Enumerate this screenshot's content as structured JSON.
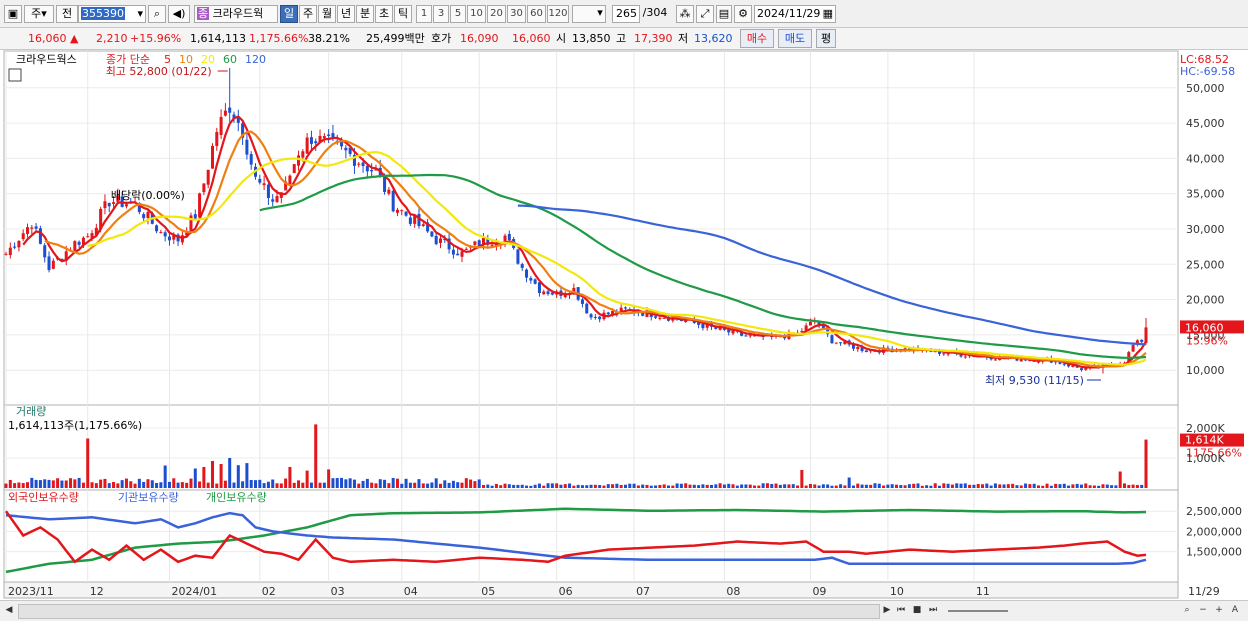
{
  "toolbar": {
    "market_type": "주",
    "prev_label": "전",
    "code": "355390",
    "name_badge": "종",
    "stock_name": "크라우드웍",
    "periods": [
      "일",
      "주",
      "월",
      "년",
      "분",
      "초",
      "틱"
    ],
    "selected_period": "일",
    "intervals": [
      "1",
      "3",
      "5",
      "10",
      "20",
      "30",
      "60",
      "120"
    ],
    "count": "265",
    "total": "/304",
    "date": "2024/11/29"
  },
  "quote": {
    "price": "16,060",
    "change_arrow": "▲",
    "change": "2,210",
    "change_pct": "+15.96%",
    "volume": "1,614,113",
    "volume_pct": "1,175.66%",
    "turnover": "38.21%",
    "amount": "25,499백만",
    "ask_label": "호가",
    "ask": "16,090",
    "bid": "16,060",
    "open_label": "시",
    "open": "13,850",
    "high_label": "고",
    "high": "17,390",
    "low_label": "저",
    "low": "13,620",
    "buy_btn": "매수",
    "sell_btn": "매도",
    "eval_btn": "평"
  },
  "chart_data": [
    {
      "type": "candlestick",
      "title": "크라우드웍스",
      "ma_label": "종가 단순",
      "ma_periods": [
        "5",
        "10",
        "20",
        "60",
        "120"
      ],
      "ma_colors": [
        "#e3161b",
        "#f07f12",
        "#f2e80c",
        "#1f9a45",
        "#3b63d9"
      ],
      "ylim": [
        5500,
        54500
      ],
      "ytick_labels": [
        "50,000",
        "45,000",
        "40,000",
        "35,000",
        "30,000",
        "25,000",
        "20,000",
        "15,000",
        "10,000"
      ],
      "yticks": [
        50000,
        45000,
        40000,
        35000,
        30000,
        25000,
        20000,
        15000,
        10000
      ],
      "x_labels": [
        "2023/11",
        "12",
        "2024/01",
        "02",
        "03",
        "04",
        "05",
        "06",
        "07",
        "08",
        "09",
        "10",
        "11",
        "11/29"
      ],
      "x_label_days": [
        0,
        19,
        38,
        59,
        75,
        92,
        110,
        128,
        146,
        167,
        187,
        205,
        225,
        265
      ],
      "close_anchor_days": [
        0,
        6,
        10,
        16,
        19,
        24,
        30,
        36,
        40,
        44,
        46,
        49,
        52,
        55,
        58,
        62,
        65,
        68,
        71,
        75,
        80,
        86,
        90,
        95,
        100,
        106,
        110,
        116,
        120,
        124,
        128,
        132,
        136,
        140,
        144,
        150,
        158,
        164,
        172,
        178,
        184,
        188,
        192,
        200,
        210,
        218,
        226,
        236,
        243,
        250,
        256,
        260,
        262,
        264,
        265
      ],
      "close_anchor_values": [
        26500,
        31000,
        24500,
        28000,
        29000,
        34000,
        33500,
        29500,
        28500,
        32000,
        36500,
        44000,
        47500,
        44000,
        37000,
        34000,
        36000,
        41000,
        43000,
        42000,
        40500,
        38000,
        33500,
        31000,
        28500,
        26500,
        28000,
        29000,
        24500,
        21500,
        20800,
        21500,
        17500,
        18000,
        18500,
        18000,
        17000,
        16000,
        14800,
        14600,
        15200,
        17000,
        14200,
        12800,
        13000,
        12500,
        12000,
        11600,
        11400,
        10200,
        10600,
        11300,
        13500,
        14200,
        16060
      ],
      "high_label": "최고 52,800 (01/22)",
      "high_value": 52800,
      "high_day": 52,
      "low_label": "최저 9,530 (11/15)",
      "low_value": 9530,
      "low_day": 255,
      "dividend_label": "배당락(0.00%)",
      "dividend_day": 36,
      "lc_label": "LC:68.52",
      "hc_label": "HC:-69.58",
      "last_price_tag": "16,060",
      "last_pct_tag": "15.96%",
      "last_close": 16060
    },
    {
      "type": "bar",
      "title": "거래량",
      "subtitle": "1,614,113주(1,175.66%)",
      "ylim": [
        0,
        2600000
      ],
      "ytick_labels": [
        "2,000K",
        "1,000K"
      ],
      "yticks": [
        2000000,
        1000000
      ],
      "last_tag": "1,614K",
      "last_pct_tag": "1175.66%",
      "spike_days": [
        19,
        37,
        44,
        46,
        48,
        50,
        52,
        54,
        56,
        66,
        70,
        72,
        75,
        185,
        196,
        259,
        265
      ],
      "spike_values": [
        1650000,
        750000,
        650000,
        700000,
        900000,
        800000,
        1000000,
        760000,
        830000,
        700000,
        580000,
        2120000,
        620000,
        600000,
        350000,
        550000,
        1614113
      ]
    },
    {
      "type": "line",
      "series_names": [
        "외국인보유수량",
        "기관보유수량",
        "개인보유수량"
      ],
      "series_colors": [
        "#e3161b",
        "#3b63d9",
        "#1f9a45"
      ],
      "ylim": [
        800000,
        2900000
      ],
      "ytick_labels": [
        "2,500,000",
        "2,000,000",
        "1,500,000"
      ],
      "yticks": [
        2500000,
        2000000,
        1500000
      ],
      "foreign_days": [
        0,
        4,
        8,
        12,
        16,
        20,
        24,
        28,
        32,
        36,
        40,
        44,
        48,
        52,
        56,
        60,
        64,
        68,
        72,
        76,
        80,
        90,
        100,
        110,
        120,
        126,
        130,
        140,
        150,
        160,
        170,
        180,
        186,
        190,
        196,
        200,
        210,
        220,
        230,
        240,
        246,
        250,
        256,
        260,
        263,
        265
      ],
      "foreign_values": [
        2500000,
        1900000,
        2100000,
        1800000,
        1250000,
        1550000,
        1300000,
        1650000,
        1300000,
        1550000,
        1250000,
        1400000,
        1350000,
        1900000,
        1700000,
        1500000,
        1450000,
        1300000,
        1800000,
        1350000,
        1250000,
        1300000,
        1250000,
        1350000,
        1300000,
        1250000,
        1400000,
        1550000,
        1600000,
        1650000,
        1750000,
        1700000,
        1750000,
        1500000,
        1500000,
        1450000,
        1550000,
        1500000,
        1550000,
        1600000,
        1650000,
        1700000,
        1750000,
        1500000,
        1400000,
        1420000
      ],
      "institution_days": [
        0,
        10,
        20,
        30,
        36,
        40,
        44,
        48,
        52,
        55,
        58,
        62,
        66,
        70,
        76,
        90,
        110,
        130,
        150,
        170,
        186,
        188,
        192,
        196,
        200,
        220,
        240,
        258,
        262,
        265
      ],
      "institution_values": [
        2400000,
        2300000,
        2350000,
        2200000,
        2300000,
        2100000,
        2200000,
        2350000,
        2450000,
        2400000,
        2100000,
        2000000,
        1950000,
        1900000,
        1850000,
        1800000,
        1600000,
        1350000,
        1300000,
        1300000,
        1300000,
        1300000,
        1350000,
        1200000,
        1200000,
        1200000,
        1200000,
        1200000,
        1220000,
        1300000
      ],
      "individual_days": [
        0,
        10,
        20,
        30,
        40,
        50,
        60,
        70,
        80,
        90,
        110,
        130,
        150,
        170,
        190,
        210,
        230,
        250,
        260,
        265
      ],
      "individual_values": [
        1000000,
        1200000,
        1300000,
        1600000,
        1700000,
        1750000,
        1900000,
        2100000,
        2400000,
        2450000,
        2470000,
        2560000,
        2510000,
        2530000,
        2490000,
        2530000,
        2490000,
        2500000,
        2470000,
        2480000
      ]
    }
  ]
}
